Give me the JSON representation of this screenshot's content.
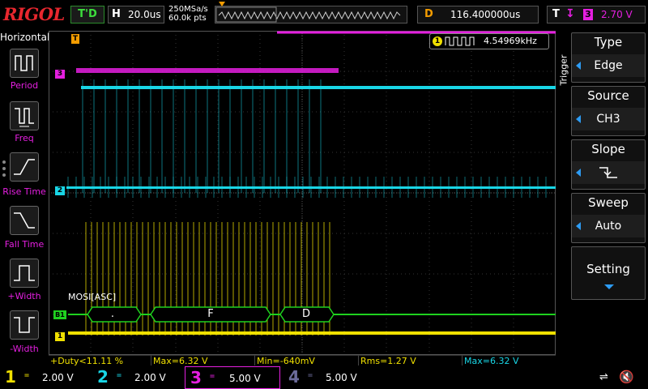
{
  "topbar": {
    "brand": "RIGOL",
    "run_status": "T'D",
    "hscale_label": "H",
    "hscale_value": "20.0us",
    "sample_rate": "250MSa/s",
    "memory_depth": "60.0k pts",
    "delay_label": "D",
    "delay_value": "116.400000us",
    "trigger_label": "T",
    "trigger_source": "3",
    "trigger_level": "2.70 V"
  },
  "left_panel": {
    "title": "Horizontal",
    "items": [
      {
        "label": "Period",
        "icon": "period-measure-icon"
      },
      {
        "label": "Freq",
        "icon": "frequency-measure-icon"
      },
      {
        "label": "Rise Time",
        "icon": "rise-time-measure-icon"
      },
      {
        "label": "Fall Time",
        "icon": "fall-time-measure-icon"
      },
      {
        "label": "+Width",
        "icon": "positive-width-measure-icon"
      },
      {
        "label": "-Width",
        "icon": "negative-width-measure-icon"
      }
    ]
  },
  "plot": {
    "freq_counter_channel": "1",
    "freq_counter_value": "4.54969kHz",
    "decode_label": "MOSI[ASC]",
    "decode_packets": [
      ".",
      "F",
      "D"
    ],
    "trigger_marker": "T",
    "channel_markers": {
      "ch1": "1",
      "ch2": "2",
      "ch3": "3",
      "bus": "B1"
    }
  },
  "right_panel": {
    "vertical_title": "Trigger",
    "menu": [
      {
        "title": "Type",
        "value": "Edge"
      },
      {
        "title": "Source",
        "value": "CH3"
      },
      {
        "title": "Slope",
        "value": "falling-edge-icon"
      },
      {
        "title": "Sweep",
        "value": "Auto"
      }
    ],
    "settings_label": "Setting"
  },
  "measurements": [
    {
      "text": "+Duty<11.11 %",
      "color": "#f0e000"
    },
    {
      "text": "Max=6.32 V",
      "color": "#f0e000"
    },
    {
      "text": "Min=-640mV",
      "color": "#f0e000"
    },
    {
      "text": "Rms=1.27 V",
      "color": "#f0e000"
    },
    {
      "text": "Max=6.32 V",
      "color": "#19d6e6"
    }
  ],
  "channels": [
    {
      "num": "1",
      "coupling": "=",
      "scale": "2.00 V",
      "color": "#f0e000"
    },
    {
      "num": "2",
      "coupling": "=",
      "scale": "2.00 V",
      "color": "#19d6e6"
    },
    {
      "num": "3",
      "coupling": "=",
      "scale": "5.00 V",
      "color": "#e51fe0"
    },
    {
      "num": "4",
      "coupling": "=",
      "scale": "5.00 V",
      "color": "#6b6b9a"
    }
  ],
  "colors": {
    "ch1": "#f0e000",
    "ch2": "#19d6e6",
    "ch3": "#e51fe0",
    "bus": "#1fd11f",
    "delay": "#f39c00"
  }
}
